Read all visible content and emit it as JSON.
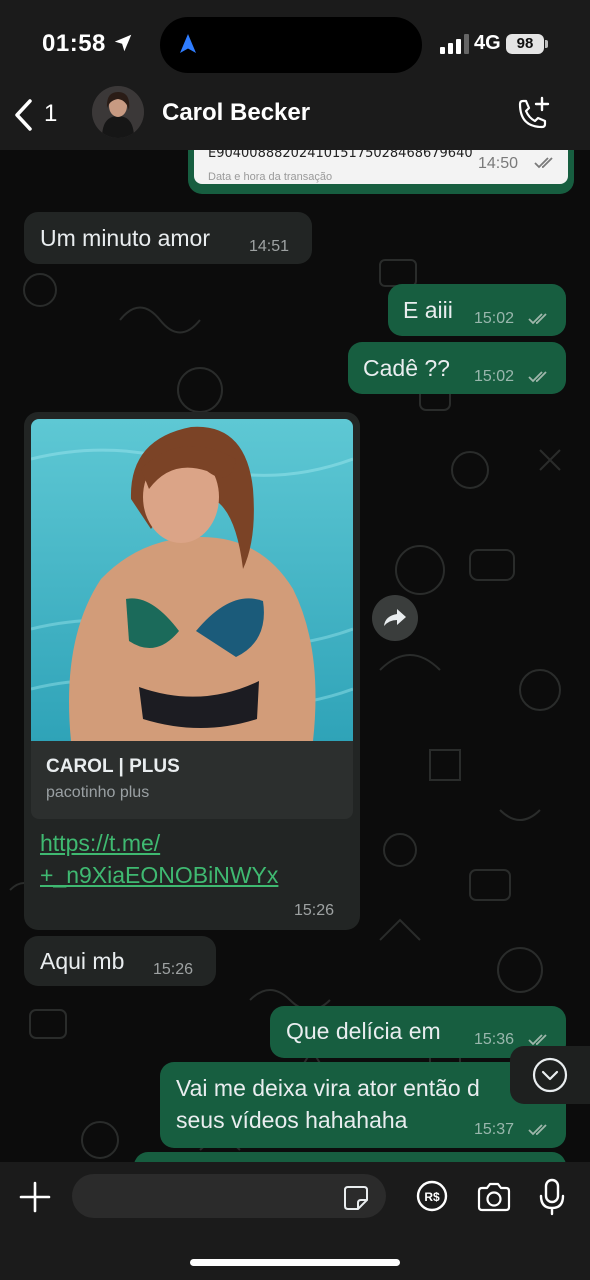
{
  "status_bar": {
    "time": "01:58",
    "network": "4G",
    "battery": "98"
  },
  "header": {
    "back_count": "1",
    "contact_name": "Carol Becker"
  },
  "top_card": {
    "transaction_code": "E9040088820241015175028468679640",
    "label": "Data e hora da transação",
    "time": "14:50"
  },
  "messages": [
    {
      "direction": "incoming",
      "text": "Um minuto amor",
      "time": "14:51"
    },
    {
      "direction": "outgoing",
      "text": "E aiii",
      "time": "15:02",
      "read": true
    },
    {
      "direction": "outgoing",
      "text": "Cadê ??",
      "time": "15:02",
      "read": true
    },
    {
      "direction": "incoming",
      "type": "link",
      "preview_title": "CAROL | PLUS",
      "preview_desc": "pacotinho plus",
      "link_line1": "https://t.me/",
      "link_line2": "+_n9XiaEONOBiNWYx",
      "time": "15:26"
    },
    {
      "direction": "incoming",
      "text": "Aqui mb",
      "time": "15:26"
    },
    {
      "direction": "outgoing",
      "text": "Que delícia em",
      "time": "15:36",
      "read": true
    },
    {
      "direction": "outgoing",
      "text_line1": "Vai me deixa vira ator então d",
      "text_line2": "seus vídeos hahahaha",
      "time": "15:37",
      "read": true
    }
  ],
  "composer": {
    "placeholder": ""
  },
  "colors": {
    "outgoing_bubble": "#175e40",
    "incoming_bubble": "#222524",
    "link": "#3fb971",
    "read_ticks": "#9fb7ab"
  }
}
